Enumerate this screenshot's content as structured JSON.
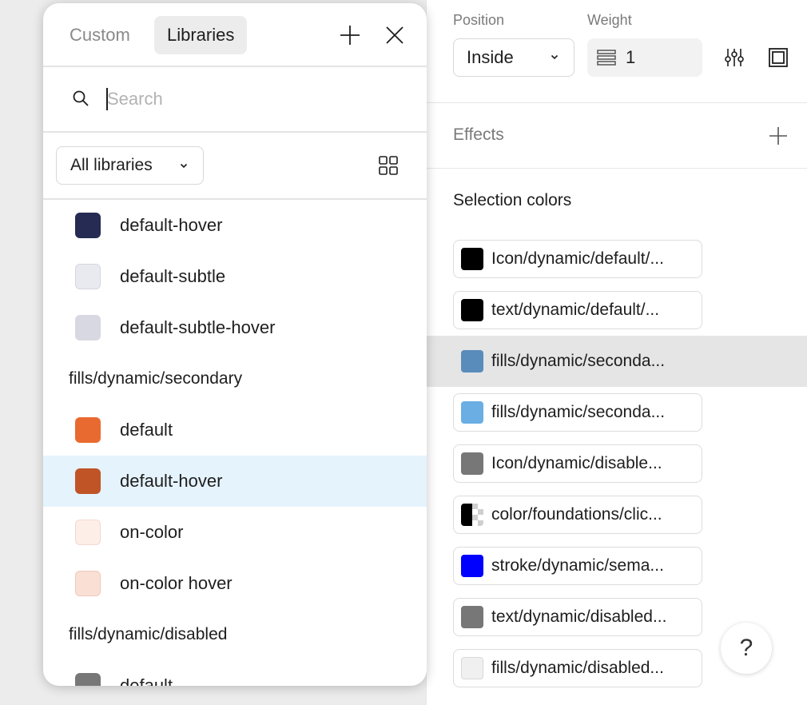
{
  "stroke": {
    "position_label": "Position",
    "position_value": "Inside",
    "weight_label": "Weight",
    "weight_value": "1"
  },
  "effects": {
    "title": "Effects"
  },
  "selection_colors": {
    "title": "Selection colors",
    "items": [
      {
        "label": "Icon/dynamic/default/...",
        "color": "#000000"
      },
      {
        "label": "text/dynamic/default/...",
        "color": "#000000"
      },
      {
        "label": "fills/dynamic/seconda...",
        "color": "#5a8cbb"
      },
      {
        "label": "fills/dynamic/seconda...",
        "color": "#6aaee3"
      },
      {
        "label": "Icon/dynamic/disable...",
        "color": "#777777"
      },
      {
        "label": "color/foundations/clic...",
        "color": "#000000"
      },
      {
        "label": "stroke/dynamic/sema...",
        "color": "#0000ff"
      },
      {
        "label": "text/dynamic/disabled...",
        "color": "#777777"
      },
      {
        "label": "fills/dynamic/disabled...",
        "color": "#f0f0f0"
      }
    ]
  },
  "help": {
    "label": "?"
  },
  "popover": {
    "tabs": {
      "custom": "Custom",
      "libraries": "Libraries"
    },
    "search": {
      "placeholder": "Search"
    },
    "library_filter": "All libraries",
    "rows": [
      {
        "name": "default-hover",
        "color": "#252b52"
      },
      {
        "name": "default-subtle",
        "color": "#e9eaef"
      },
      {
        "name": "default-subtle-hover",
        "color": "#d7d8e1"
      },
      {
        "group": "fills/dynamic/secondary"
      },
      {
        "name": "default",
        "color": "#e96a30"
      },
      {
        "name": "default-hover",
        "color": "#c05426",
        "selected": true
      },
      {
        "name": "on-color",
        "color": "#fdefe8"
      },
      {
        "name": "on-color hover",
        "color": "#fadfd4"
      },
      {
        "group": "fills/dynamic/disabled"
      },
      {
        "name": "default",
        "color": "#777777"
      }
    ]
  }
}
